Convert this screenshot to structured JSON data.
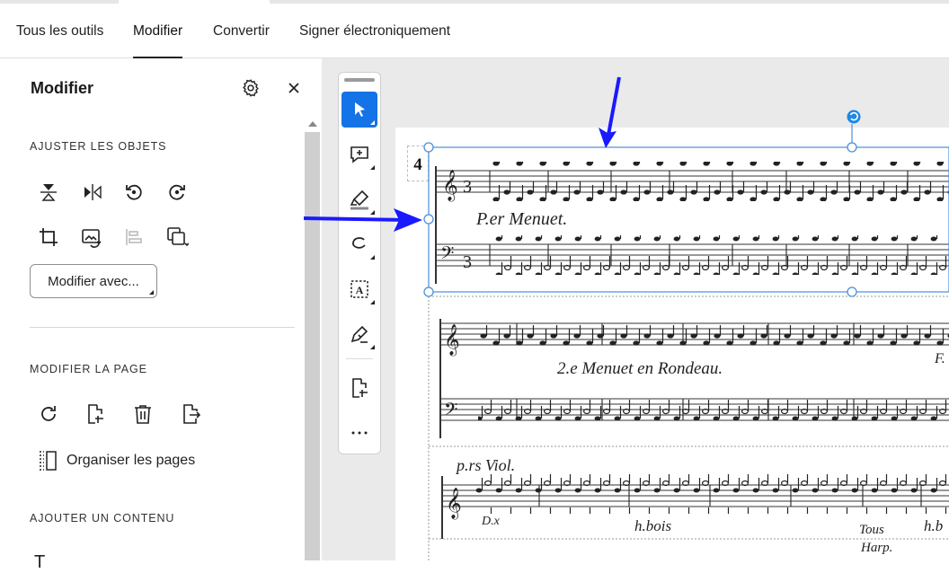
{
  "tabs": [
    {
      "label": "Tous les outils"
    },
    {
      "label": "Modifier"
    },
    {
      "label": "Convertir"
    },
    {
      "label": "Signer électroniquement"
    }
  ],
  "panel": {
    "title": "Modifier",
    "section_adjust": "AJUSTER LES OBJETS",
    "edit_with_label": "Modifier avec...",
    "section_page": "MODIFIER LA PAGE",
    "organize_label": "Organiser les pages",
    "section_add": "AJOUTER UN CONTENU",
    "partial_next_item": "T"
  },
  "document": {
    "page_number": "4",
    "score_texts": {
      "menuet1": "P.er Menuet.",
      "menuet2": "2.e Menuet en Rondeau.",
      "violin": "p.rs Viol.",
      "dx": "D.x",
      "hbois": "h.bois",
      "tous": "Tous",
      "hb": "h.b",
      "harp": "Harp.",
      "f": "F."
    }
  },
  "colors": {
    "accent": "#1473e6",
    "annotation_arrow": "#1a1aff",
    "selection": "#4a90d9"
  }
}
